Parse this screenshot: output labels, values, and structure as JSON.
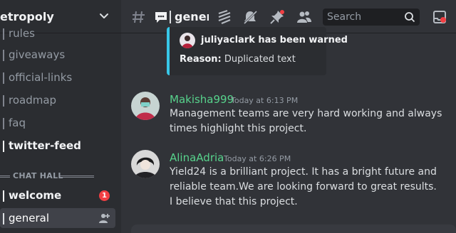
{
  "server": {
    "name": "etropoly"
  },
  "sidebar": {
    "channels": [
      {
        "name": "rules",
        "state": "muted"
      },
      {
        "name": "giveaways",
        "state": "muted"
      },
      {
        "name": "official-links",
        "state": "muted"
      },
      {
        "name": "roadmap",
        "state": "muted"
      },
      {
        "name": "faq",
        "state": "muted"
      },
      {
        "name": "twitter-feed",
        "state": "unread"
      }
    ],
    "category": "CHAT HALL",
    "chat_channels": [
      {
        "name": "welcome",
        "badge": "1"
      },
      {
        "name": "general",
        "active": true
      }
    ]
  },
  "header": {
    "channel": "general",
    "search_placeholder": "Search",
    "icons": [
      "threads-icon",
      "chat-icon",
      "notification-settings-icon",
      "pinned-icon",
      "members-icon",
      "inbox-icon"
    ]
  },
  "messages": {
    "embed": {
      "warned_text": "juliyaclark has been warned",
      "reason_label": "Reason:",
      "reason_text": "Duplicated text"
    },
    "items": [
      {
        "author": "Makisha999",
        "timestamp": "Today at 6:13 PM",
        "lines": [
          "Management teams are very hard working and always",
          "times highlight this project."
        ]
      },
      {
        "author": "AlinaAdria",
        "timestamp": "Today at 6:26 PM",
        "lines": [
          "Yield24 is a brilliant project. It has a bright future and",
          "reliable team.We are looking forward to great results.",
          "I believe that this project."
        ]
      }
    ]
  },
  "colors": {
    "accent_stripe": "#38c7e8",
    "author_name": "#57d38c",
    "badge": "#f23f43"
  }
}
